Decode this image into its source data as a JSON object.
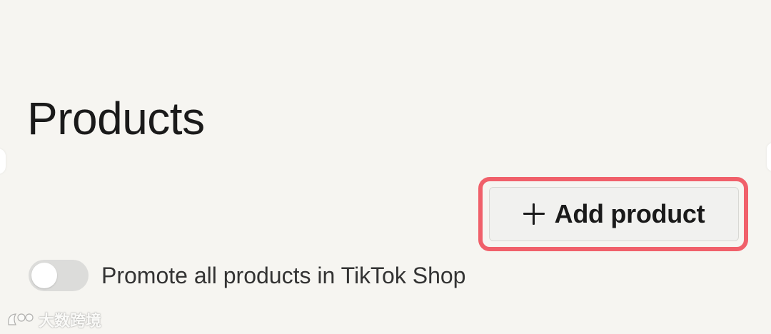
{
  "header": {
    "title": "Products"
  },
  "actions": {
    "add_product_label": "Add product",
    "add_icon": "plus-icon",
    "highlight_color": "#f0606a"
  },
  "promote": {
    "label": "Promote all products in TikTok Shop",
    "enabled": false
  },
  "watermark": {
    "text": "大数跨境"
  }
}
